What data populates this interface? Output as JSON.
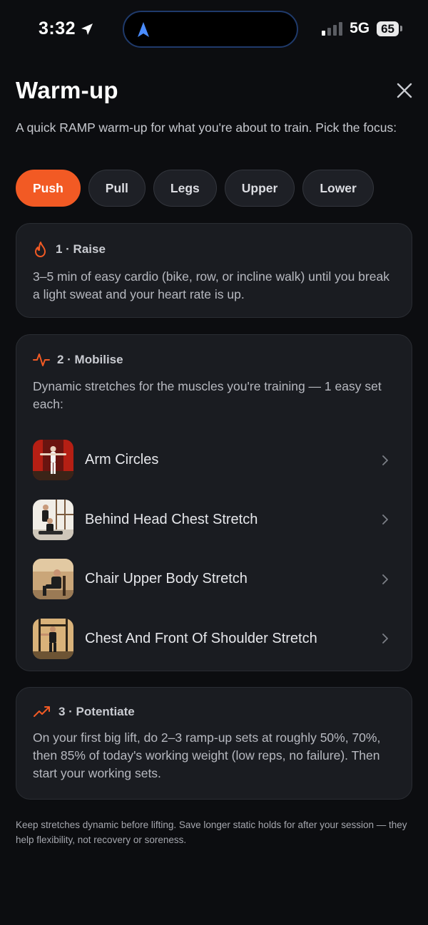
{
  "status_bar": {
    "time": "3:32",
    "network": "5G",
    "battery": "65"
  },
  "header": {
    "title": "Warm-up",
    "subtitle": "A quick RAMP warm-up for what you're about to train. Pick the focus:"
  },
  "focus_chips": [
    {
      "label": "Push",
      "active": true
    },
    {
      "label": "Pull",
      "active": false
    },
    {
      "label": "Legs",
      "active": false
    },
    {
      "label": "Upper",
      "active": false
    },
    {
      "label": "Lower",
      "active": false
    }
  ],
  "steps": {
    "raise": {
      "title": "1 · Raise",
      "text": "3–5 min of easy cardio (bike, row, or incline walk) until you break a light sweat and your heart rate is up.",
      "icon": "flame-icon"
    },
    "mobilise": {
      "title": "2 · Mobilise",
      "text": "Dynamic stretches for the muscles you're training — 1 easy set each:",
      "icon": "pulse-icon",
      "exercises": [
        {
          "name": "Arm Circles"
        },
        {
          "name": "Behind Head Chest Stretch"
        },
        {
          "name": "Chair Upper Body Stretch"
        },
        {
          "name": "Chest And Front Of Shoulder Stretch"
        }
      ]
    },
    "potentiate": {
      "title": "3 · Potentiate",
      "text": "On your first big lift, do 2–3 ramp-up sets at roughly 50%, 70%, then 85% of today's working weight (low reps, no failure). Then start your working sets.",
      "icon": "trending-up-icon"
    }
  },
  "footnote": "Keep stretches dynamic before lifting. Save longer static holds for after your session — they help flexibility, not recovery or soreness.",
  "colors": {
    "accent": "#f25a24",
    "background": "#0c0d10",
    "card": "#1a1c21"
  }
}
